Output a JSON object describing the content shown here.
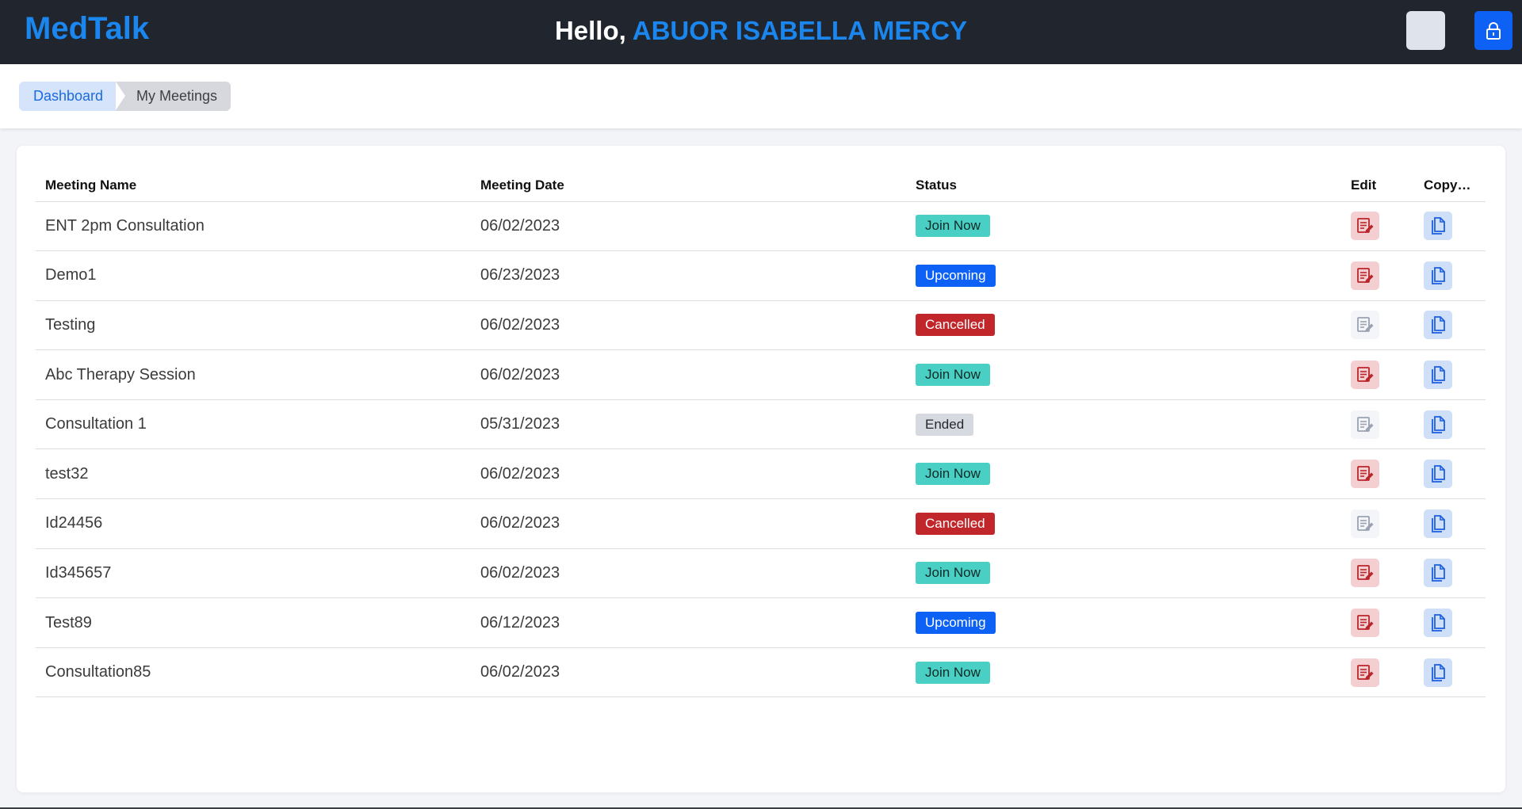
{
  "header": {
    "logo": "MedTalk",
    "greeting_prefix": "Hello, ",
    "user_name": "ABUOR ISABELLA MERCY",
    "lock_icon": "lock-icon"
  },
  "breadcrumb": {
    "items": [
      "Dashboard",
      "My Meetings"
    ]
  },
  "table": {
    "columns": [
      "Meeting Name",
      "Meeting Date",
      "Status",
      "Edit",
      "Copy…"
    ],
    "rows": [
      {
        "name": "ENT 2pm Consultation",
        "date": "06/02/2023",
        "status": "Join Now"
      },
      {
        "name": "Demo1",
        "date": "06/23/2023",
        "status": "Upcoming"
      },
      {
        "name": "Testing",
        "date": "06/02/2023",
        "status": "Cancelled"
      },
      {
        "name": "Abc Therapy Session",
        "date": "06/02/2023",
        "status": "Join Now"
      },
      {
        "name": "Consultation 1",
        "date": "05/31/2023",
        "status": "Ended"
      },
      {
        "name": "test32",
        "date": "06/02/2023",
        "status": "Join Now"
      },
      {
        "name": "Id24456",
        "date": "06/02/2023",
        "status": "Cancelled"
      },
      {
        "name": "Id345657",
        "date": "06/02/2023",
        "status": "Join Now"
      },
      {
        "name": "Test89",
        "date": "06/12/2023",
        "status": "Upcoming"
      },
      {
        "name": "Consultation85",
        "date": "06/02/2023",
        "status": "Join Now"
      }
    ]
  },
  "colors": {
    "brand": "#1a86ee",
    "topbar": "#21252d",
    "join_now": "#49cfc3",
    "upcoming": "#0d62f5",
    "cancelled": "#c0262a",
    "ended": "#d6d9e0"
  }
}
